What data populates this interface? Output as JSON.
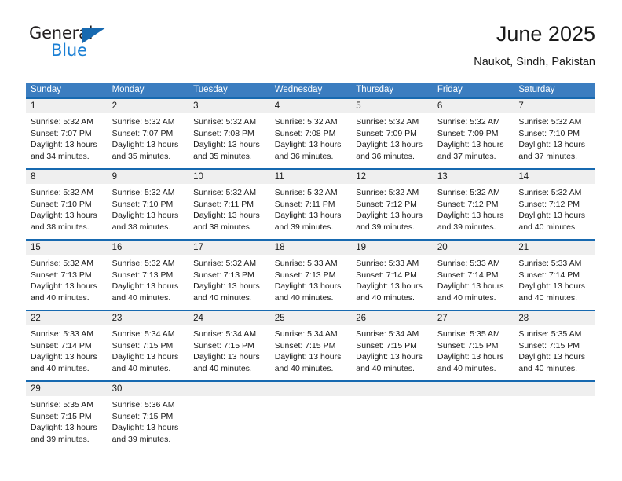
{
  "brand": {
    "name_part1": "General",
    "name_part2": "Blue",
    "triangle_icon": "triangle-icon",
    "accent_color": "#1a7fd4"
  },
  "header": {
    "title": "June 2025",
    "subtitle": "Naukot, Sindh, Pakistan"
  },
  "colors": {
    "header_bg": "#3b7dc0",
    "row_divider": "#1769b0",
    "daynum_bg": "#efefef",
    "text": "#1a1a1a"
  },
  "calendar": {
    "day_headers": [
      "Sunday",
      "Monday",
      "Tuesday",
      "Wednesday",
      "Thursday",
      "Friday",
      "Saturday"
    ],
    "weeks": [
      [
        {
          "day": "1",
          "sunrise": "Sunrise: 5:32 AM",
          "sunset": "Sunset: 7:07 PM",
          "daylight1": "Daylight: 13 hours",
          "daylight2": "and 34 minutes."
        },
        {
          "day": "2",
          "sunrise": "Sunrise: 5:32 AM",
          "sunset": "Sunset: 7:07 PM",
          "daylight1": "Daylight: 13 hours",
          "daylight2": "and 35 minutes."
        },
        {
          "day": "3",
          "sunrise": "Sunrise: 5:32 AM",
          "sunset": "Sunset: 7:08 PM",
          "daylight1": "Daylight: 13 hours",
          "daylight2": "and 35 minutes."
        },
        {
          "day": "4",
          "sunrise": "Sunrise: 5:32 AM",
          "sunset": "Sunset: 7:08 PM",
          "daylight1": "Daylight: 13 hours",
          "daylight2": "and 36 minutes."
        },
        {
          "day": "5",
          "sunrise": "Sunrise: 5:32 AM",
          "sunset": "Sunset: 7:09 PM",
          "daylight1": "Daylight: 13 hours",
          "daylight2": "and 36 minutes."
        },
        {
          "day": "6",
          "sunrise": "Sunrise: 5:32 AM",
          "sunset": "Sunset: 7:09 PM",
          "daylight1": "Daylight: 13 hours",
          "daylight2": "and 37 minutes."
        },
        {
          "day": "7",
          "sunrise": "Sunrise: 5:32 AM",
          "sunset": "Sunset: 7:10 PM",
          "daylight1": "Daylight: 13 hours",
          "daylight2": "and 37 minutes."
        }
      ],
      [
        {
          "day": "8",
          "sunrise": "Sunrise: 5:32 AM",
          "sunset": "Sunset: 7:10 PM",
          "daylight1": "Daylight: 13 hours",
          "daylight2": "and 38 minutes."
        },
        {
          "day": "9",
          "sunrise": "Sunrise: 5:32 AM",
          "sunset": "Sunset: 7:10 PM",
          "daylight1": "Daylight: 13 hours",
          "daylight2": "and 38 minutes."
        },
        {
          "day": "10",
          "sunrise": "Sunrise: 5:32 AM",
          "sunset": "Sunset: 7:11 PM",
          "daylight1": "Daylight: 13 hours",
          "daylight2": "and 38 minutes."
        },
        {
          "day": "11",
          "sunrise": "Sunrise: 5:32 AM",
          "sunset": "Sunset: 7:11 PM",
          "daylight1": "Daylight: 13 hours",
          "daylight2": "and 39 minutes."
        },
        {
          "day": "12",
          "sunrise": "Sunrise: 5:32 AM",
          "sunset": "Sunset: 7:12 PM",
          "daylight1": "Daylight: 13 hours",
          "daylight2": "and 39 minutes."
        },
        {
          "day": "13",
          "sunrise": "Sunrise: 5:32 AM",
          "sunset": "Sunset: 7:12 PM",
          "daylight1": "Daylight: 13 hours",
          "daylight2": "and 39 minutes."
        },
        {
          "day": "14",
          "sunrise": "Sunrise: 5:32 AM",
          "sunset": "Sunset: 7:12 PM",
          "daylight1": "Daylight: 13 hours",
          "daylight2": "and 40 minutes."
        }
      ],
      [
        {
          "day": "15",
          "sunrise": "Sunrise: 5:32 AM",
          "sunset": "Sunset: 7:13 PM",
          "daylight1": "Daylight: 13 hours",
          "daylight2": "and 40 minutes."
        },
        {
          "day": "16",
          "sunrise": "Sunrise: 5:32 AM",
          "sunset": "Sunset: 7:13 PM",
          "daylight1": "Daylight: 13 hours",
          "daylight2": "and 40 minutes."
        },
        {
          "day": "17",
          "sunrise": "Sunrise: 5:32 AM",
          "sunset": "Sunset: 7:13 PM",
          "daylight1": "Daylight: 13 hours",
          "daylight2": "and 40 minutes."
        },
        {
          "day": "18",
          "sunrise": "Sunrise: 5:33 AM",
          "sunset": "Sunset: 7:13 PM",
          "daylight1": "Daylight: 13 hours",
          "daylight2": "and 40 minutes."
        },
        {
          "day": "19",
          "sunrise": "Sunrise: 5:33 AM",
          "sunset": "Sunset: 7:14 PM",
          "daylight1": "Daylight: 13 hours",
          "daylight2": "and 40 minutes."
        },
        {
          "day": "20",
          "sunrise": "Sunrise: 5:33 AM",
          "sunset": "Sunset: 7:14 PM",
          "daylight1": "Daylight: 13 hours",
          "daylight2": "and 40 minutes."
        },
        {
          "day": "21",
          "sunrise": "Sunrise: 5:33 AM",
          "sunset": "Sunset: 7:14 PM",
          "daylight1": "Daylight: 13 hours",
          "daylight2": "and 40 minutes."
        }
      ],
      [
        {
          "day": "22",
          "sunrise": "Sunrise: 5:33 AM",
          "sunset": "Sunset: 7:14 PM",
          "daylight1": "Daylight: 13 hours",
          "daylight2": "and 40 minutes."
        },
        {
          "day": "23",
          "sunrise": "Sunrise: 5:34 AM",
          "sunset": "Sunset: 7:15 PM",
          "daylight1": "Daylight: 13 hours",
          "daylight2": "and 40 minutes."
        },
        {
          "day": "24",
          "sunrise": "Sunrise: 5:34 AM",
          "sunset": "Sunset: 7:15 PM",
          "daylight1": "Daylight: 13 hours",
          "daylight2": "and 40 minutes."
        },
        {
          "day": "25",
          "sunrise": "Sunrise: 5:34 AM",
          "sunset": "Sunset: 7:15 PM",
          "daylight1": "Daylight: 13 hours",
          "daylight2": "and 40 minutes."
        },
        {
          "day": "26",
          "sunrise": "Sunrise: 5:34 AM",
          "sunset": "Sunset: 7:15 PM",
          "daylight1": "Daylight: 13 hours",
          "daylight2": "and 40 minutes."
        },
        {
          "day": "27",
          "sunrise": "Sunrise: 5:35 AM",
          "sunset": "Sunset: 7:15 PM",
          "daylight1": "Daylight: 13 hours",
          "daylight2": "and 40 minutes."
        },
        {
          "day": "28",
          "sunrise": "Sunrise: 5:35 AM",
          "sunset": "Sunset: 7:15 PM",
          "daylight1": "Daylight: 13 hours",
          "daylight2": "and 40 minutes."
        }
      ],
      [
        {
          "day": "29",
          "sunrise": "Sunrise: 5:35 AM",
          "sunset": "Sunset: 7:15 PM",
          "daylight1": "Daylight: 13 hours",
          "daylight2": "and 39 minutes."
        },
        {
          "day": "30",
          "sunrise": "Sunrise: 5:36 AM",
          "sunset": "Sunset: 7:15 PM",
          "daylight1": "Daylight: 13 hours",
          "daylight2": "and 39 minutes."
        },
        {
          "day": "",
          "sunrise": "",
          "sunset": "",
          "daylight1": "",
          "daylight2": ""
        },
        {
          "day": "",
          "sunrise": "",
          "sunset": "",
          "daylight1": "",
          "daylight2": ""
        },
        {
          "day": "",
          "sunrise": "",
          "sunset": "",
          "daylight1": "",
          "daylight2": ""
        },
        {
          "day": "",
          "sunrise": "",
          "sunset": "",
          "daylight1": "",
          "daylight2": ""
        },
        {
          "day": "",
          "sunrise": "",
          "sunset": "",
          "daylight1": "",
          "daylight2": ""
        }
      ]
    ]
  }
}
